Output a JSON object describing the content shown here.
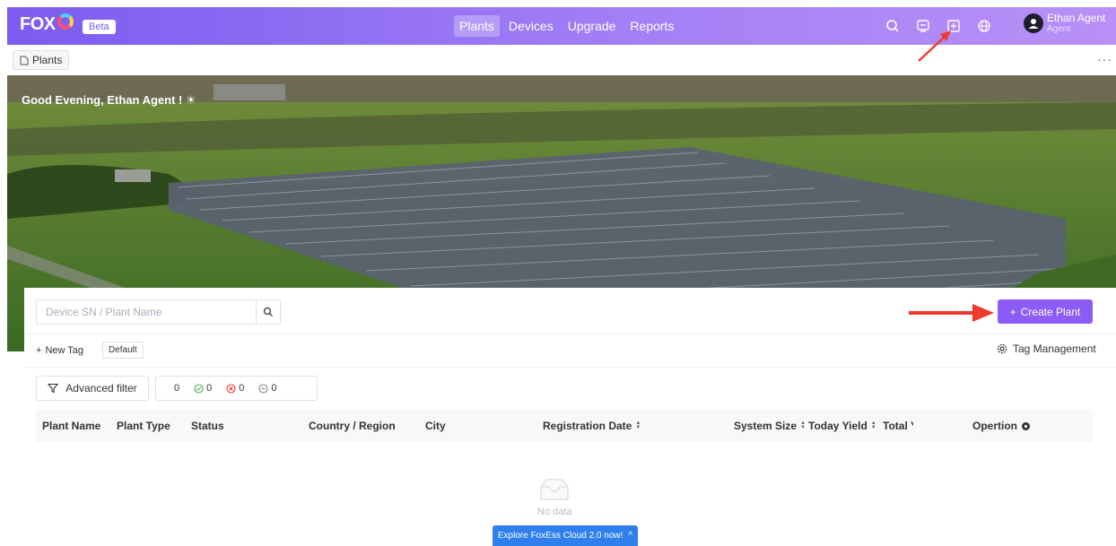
{
  "header": {
    "logo_text": "FOX",
    "beta": "Beta",
    "nav": [
      "Plants",
      "Devices",
      "Upgrade",
      "Reports"
    ],
    "active_nav": "Plants",
    "user_name": "Ethan Agent",
    "user_role": "Agent",
    "icons": [
      "search-icon",
      "message-icon",
      "add-box-icon",
      "globe-icon"
    ]
  },
  "breadcrumb": {
    "label": "Plants",
    "more": "···"
  },
  "banner": {
    "greeting": "Good Evening, Ethan Agent ! ☀"
  },
  "toolbar": {
    "search_placeholder": "Device SN / Plant Name",
    "create_label": "Create Plant",
    "new_tag": "New Tag",
    "default_tag": "Default",
    "tag_management": "Tag Management",
    "advanced_filter": "Advanced filter",
    "counts": {
      "total": "0",
      "normal": "0",
      "fault": "0",
      "offline": "0"
    }
  },
  "table": {
    "columns": [
      "Plant Name",
      "Plant Type",
      "Status",
      "Country / Region",
      "City",
      "Registration Date",
      "System Size",
      "Today Yield",
      "Total Y",
      "Opertion"
    ],
    "empty_text": "No data"
  },
  "footer": {
    "explore": "Explore FoxEss Cloud 2.0 now!"
  },
  "colors": {
    "primary": "#8b5cf6",
    "header_start": "#7b5cf0",
    "header_end": "#b890f7",
    "explore": "#2f80ed",
    "annotation": "#ef3b2c"
  }
}
